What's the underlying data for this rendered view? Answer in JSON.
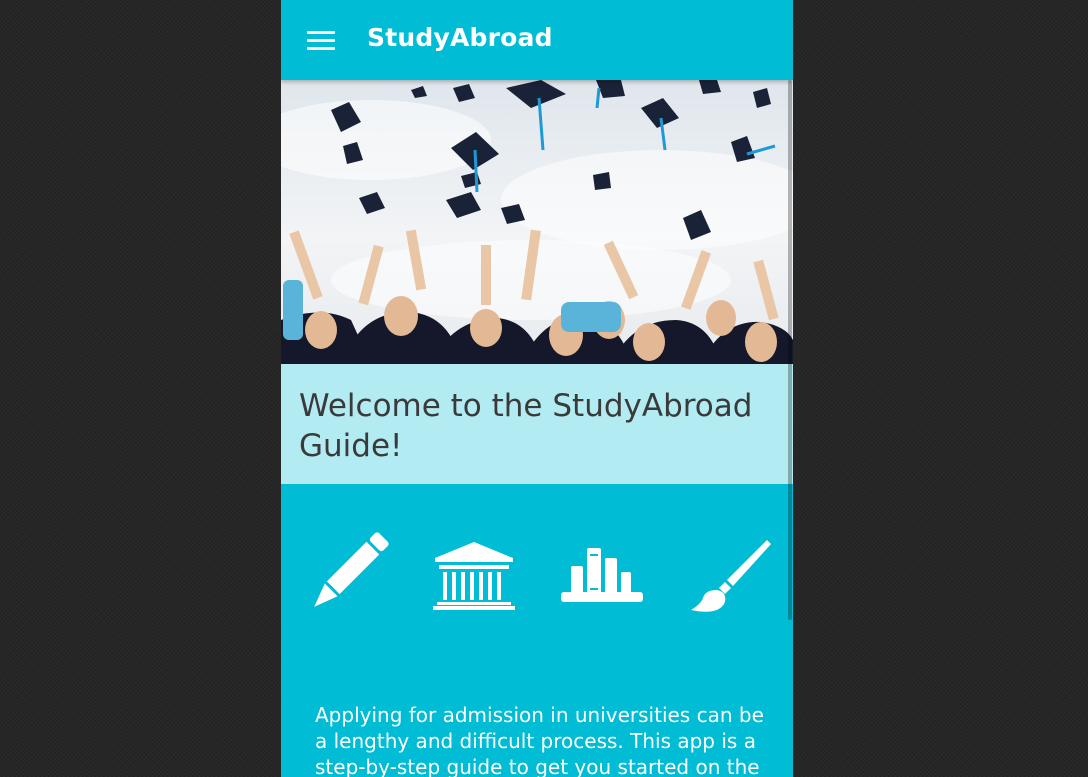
{
  "app_bar": {
    "title": "StudyAbroad",
    "menu_icon": "hamburger-menu-icon",
    "background_color": "#00bcd4"
  },
  "hero": {
    "image": "graduation-caps-celebration"
  },
  "welcome": {
    "heading": "Welcome to the StudyAbroad Guide!",
    "background_color": "#b2ebf2"
  },
  "feature_icons": [
    {
      "icon": "pencil-icon"
    },
    {
      "icon": "university-building-icon"
    },
    {
      "icon": "books-icon"
    },
    {
      "icon": "paintbrush-icon"
    }
  ],
  "intro": {
    "text": "Applying for admission in universities can be a lengthy and difficult process. This app is a step-by-step guide to get you started on the"
  }
}
